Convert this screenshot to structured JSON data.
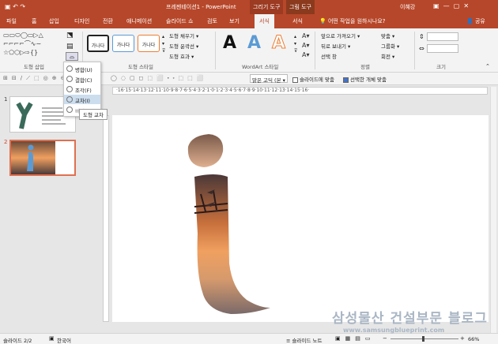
{
  "window": {
    "title": "프레젠테이션1 - PowerPoint",
    "context_tab_1": "그리기 도구",
    "context_tab_2": "그림 도구",
    "user": "이혜강"
  },
  "tabs": [
    "파일",
    "홈",
    "삽입",
    "디자인",
    "전환",
    "애니메이션",
    "슬라이드 쇼",
    "검토",
    "보기",
    "서식",
    "서식"
  ],
  "active_tab_index": 9,
  "tell_me": "어떤 작업을 원하시나요?",
  "share": "공유",
  "ribbon": {
    "insert_shapes_label": "도형 삽입",
    "shape_styles_label": "도형 스타일",
    "style_btn": "가나다",
    "fill": "도형 채우기 ▾",
    "outline": "도형 윤곽선 ▾",
    "effects": "도형 효과 ▾",
    "wordart_label": "WordArt 스타일",
    "wordart_glyph": "A",
    "bring_forward": "앞으로 가져오기 ▾",
    "send_backward": "뒤로 보내기 ▾",
    "selection_pane": "선택 창",
    "align": "맞춤 ▾",
    "group": "그룹화 ▾",
    "rotate": "회전 ▾",
    "arrange_label": "정렬",
    "size_label": "크기"
  },
  "merge_menu": {
    "items": [
      "병합(U)",
      "결합(C)",
      "조각(F)",
      "교차(I)",
      "빼기(S)"
    ],
    "highlighted": 3,
    "tooltip": "도형 교차"
  },
  "toolbar2": {
    "font": "맑은 고딕 (본 ▾",
    "fit_slide": "슬라이드에 맞춤",
    "fit_selected": "선택한 개체 맞춤"
  },
  "slides": [
    {
      "number": "1"
    },
    {
      "number": "2"
    }
  ],
  "ruler_text": "·16·15·14·13·12·11·10·9·8·7·6·5·4·3·2·1·0·1·2·3·4·5·6·7·8·9·10·11·12·13·14·15·16·",
  "status": {
    "slide": "슬라이드 2/2",
    "language": "한국어",
    "notes": "슬라이드 노트",
    "zoom": "66%"
  },
  "watermark": "삼성물산 건설부문 블로그",
  "watermark_url": "www.samsungblueprint.com",
  "colors": {
    "accent": "#b7472a",
    "sunset_top": "#f0a060",
    "sunset_mid": "#c8703c",
    "sunset_bottom": "#6b4a3a",
    "selected_border": "#e07050"
  }
}
